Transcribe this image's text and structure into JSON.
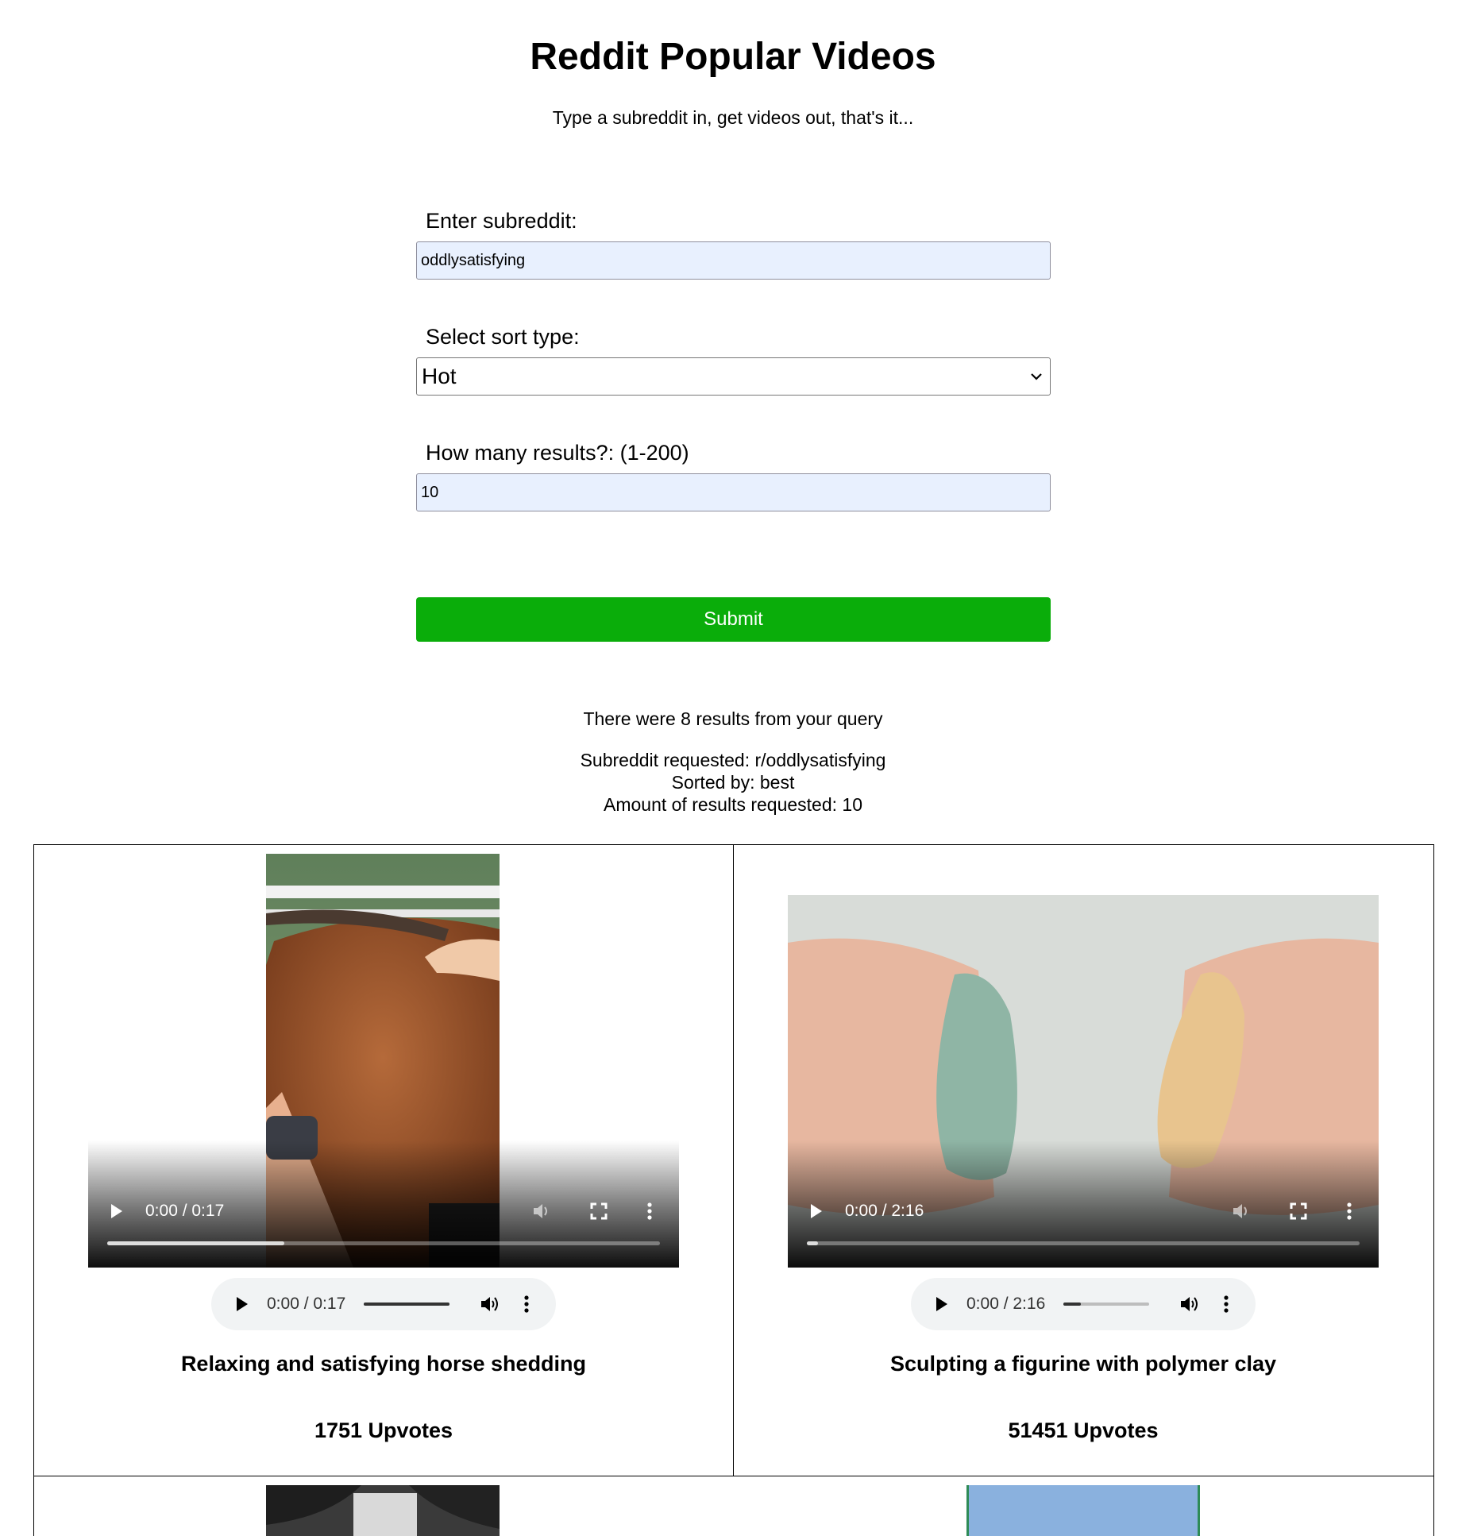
{
  "header": {
    "title": "Reddit Popular Videos",
    "subtitle": "Type a subreddit in, get videos out, that's it..."
  },
  "form": {
    "subreddit_label": "Enter subreddit:",
    "subreddit_value": "oddlysatisfying",
    "sort_label": "Select sort type:",
    "sort_value": "Hot",
    "count_label": "How many results?: (1-200)",
    "count_value": "10",
    "submit_label": "Submit"
  },
  "results": {
    "summary": "There were 8 results from your query",
    "subreddit_line": "Subreddit requested: r/oddlysatisfying",
    "sorted_line": "Sorted by: best",
    "amount_line": "Amount of results requested: 10"
  },
  "posts": [
    {
      "title": "Relaxing and satisfying horse shedding",
      "upvotes": "1751 Upvotes",
      "video_time": "0:00 / 0:17",
      "audio_time": "0:00 / 0:17",
      "video_progress": 0.32,
      "audio_progress": 1.0
    },
    {
      "title": "Sculpting a figurine with polymer clay",
      "upvotes": "51451 Upvotes",
      "video_time": "0:00 / 2:16",
      "audio_time": "0:00 / 2:16",
      "video_progress": 0.02,
      "audio_progress": 0.2
    }
  ],
  "colors": {
    "submit": "#0aad0a",
    "input_bg": "#e8f0fe",
    "audio_bg": "#f1f3f4"
  }
}
